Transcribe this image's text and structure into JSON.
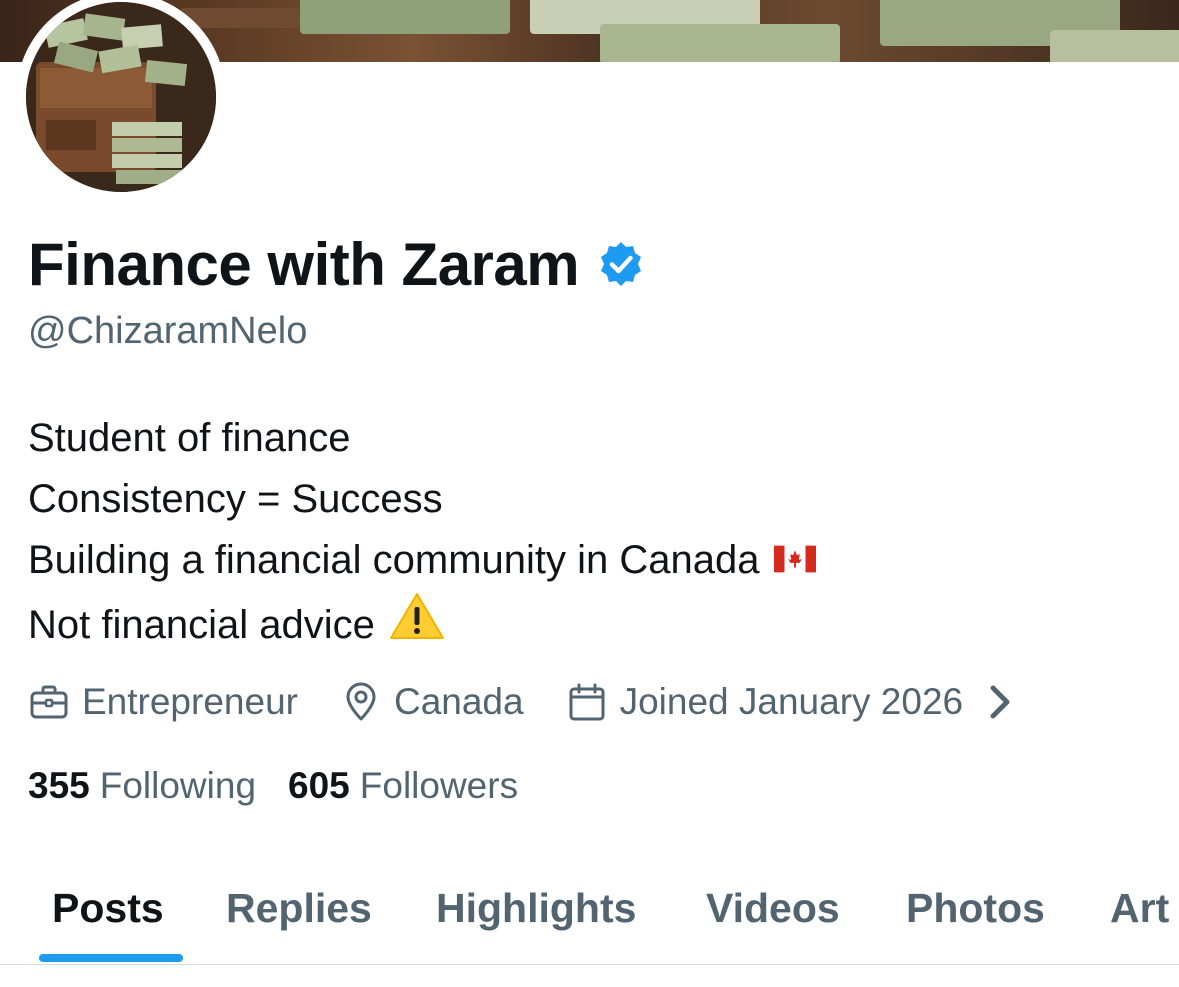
{
  "profile": {
    "display_name": "Finance with Zaram",
    "handle": "@ChizaramNelo",
    "verified_icon": "verified-badge-icon",
    "bio_lines": [
      "Student of finance",
      "Consistency = Success",
      "Building a financial community in Canada",
      "Not financial advice"
    ],
    "bio_emojis": {
      "canada_flag": "🇨🇦",
      "warning": "⚠️"
    },
    "meta": {
      "profession": "Entrepreneur",
      "location": "Canada",
      "joined": "Joined January 2026"
    },
    "stats": {
      "following_count": "355",
      "following_label": "Following",
      "followers_count": "605",
      "followers_label": "Followers"
    }
  },
  "tabs": [
    {
      "label": "Posts",
      "active": true
    },
    {
      "label": "Replies",
      "active": false
    },
    {
      "label": "Highlights",
      "active": false
    },
    {
      "label": "Videos",
      "active": false
    },
    {
      "label": "Photos",
      "active": false
    },
    {
      "label": "Art",
      "active": false
    }
  ],
  "colors": {
    "accent": "#1d9bf0",
    "text_primary": "#0f1419",
    "text_secondary": "#536471",
    "divider": "#cfd9de"
  },
  "icons": {
    "profession": "briefcase-icon",
    "location": "location-pin-icon",
    "joined": "calendar-icon",
    "expand": "chevron-right-icon"
  }
}
